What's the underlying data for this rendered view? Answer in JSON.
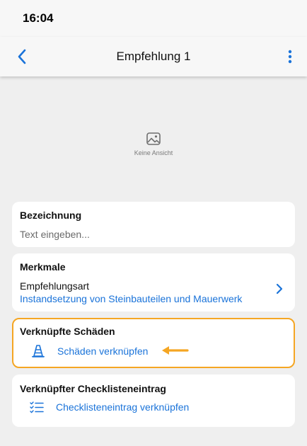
{
  "status_bar": {
    "time": "16:04"
  },
  "nav": {
    "title": "Empfehlung 1",
    "back_icon": "chevron-left-icon",
    "more_icon": "more-vertical-icon"
  },
  "image_placeholder": {
    "icon": "image-icon",
    "label": "Keine Ansicht"
  },
  "bezeichnung": {
    "title": "Bezeichnung",
    "placeholder": "Text eingeben..."
  },
  "merkmale": {
    "title": "Merkmale",
    "field_label": "Empfehlungsart",
    "field_value": "Instandsetzung von Steinbauteilen und Mauerwerk"
  },
  "schaeden": {
    "title": "Verknüpfte Schäden",
    "link_label": "Schäden verknüpfen",
    "link_icon": "warning-cone-icon"
  },
  "checkliste": {
    "title": "Verknüpfter Checklisteneintrag",
    "link_label": "Checklisteneintrag verknüpfen",
    "link_icon": "checklist-icon"
  },
  "colors": {
    "accent": "#1a73d9",
    "highlight": "#f5a623",
    "background": "#efefef",
    "card": "#ffffff"
  }
}
